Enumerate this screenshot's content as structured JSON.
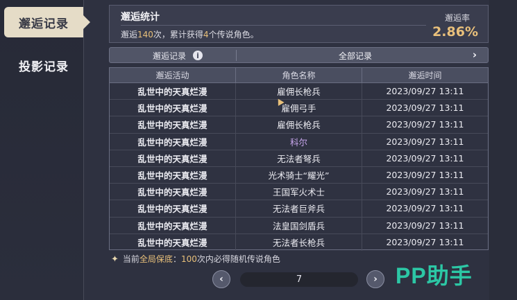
{
  "nav": {
    "encounter_tab": "邂逅记录",
    "projection_tab": "投影记录"
  },
  "stats": {
    "title": "邂逅统计",
    "summary_prefix": "邂逅",
    "count": "140",
    "summary_mid": "次，累计获得",
    "legend_count": "4",
    "summary_suffix": "个传说角色。",
    "rate_label": "邂逅率",
    "rate_value": "2.86%"
  },
  "filter": {
    "label": "邂逅记录",
    "info_icon": "i",
    "value": "全部记录",
    "arrow": "›"
  },
  "table": {
    "headers": [
      "邂逅活动",
      "角色名称",
      "邂逅时间"
    ],
    "rows": [
      {
        "activity": "乱世中的天真烂漫",
        "name": "雇佣长枪兵",
        "time": "2023/09/27 13:11",
        "name_color": "#ececf2"
      },
      {
        "activity": "乱世中的天真烂漫",
        "name": "雇佣弓手",
        "time": "2023/09/27 13:11",
        "name_color": "#ececf2"
      },
      {
        "activity": "乱世中的天真烂漫",
        "name": "雇佣长枪兵",
        "time": "2023/09/27 13:11",
        "name_color": "#ececf2"
      },
      {
        "activity": "乱世中的天真烂漫",
        "name": "科尔",
        "time": "2023/09/27 13:11",
        "name_color": "#c9a7ee"
      },
      {
        "activity": "乱世中的天真烂漫",
        "name": "无法者弩兵",
        "time": "2023/09/27 13:11",
        "name_color": "#ececf2"
      },
      {
        "activity": "乱世中的天真烂漫",
        "name": "光术骑士“耀光”",
        "time": "2023/09/27 13:11",
        "name_color": "#ececf2"
      },
      {
        "activity": "乱世中的天真烂漫",
        "name": "王国军火术士",
        "time": "2023/09/27 13:11",
        "name_color": "#ececf2"
      },
      {
        "activity": "乱世中的天真烂漫",
        "name": "无法者巨斧兵",
        "time": "2023/09/27 13:11",
        "name_color": "#ececf2"
      },
      {
        "activity": "乱世中的天真烂漫",
        "name": "法皇国剑盾兵",
        "time": "2023/09/27 13:11",
        "name_color": "#ececf2"
      },
      {
        "activity": "乱世中的天真烂漫",
        "name": "无法者长枪兵",
        "time": "2023/09/27 13:11",
        "name_color": "#ececf2"
      }
    ]
  },
  "note": {
    "prefix": "当前",
    "highlight1": "全局保底",
    "mid": "：",
    "highlight2": "100",
    "suffix": "次内必得随机传说角色"
  },
  "pagination": {
    "prev": "‹",
    "current_page": "7",
    "next": "›"
  },
  "watermark": "PP助手",
  "colors": {
    "accent_gold": "#e8c07a",
    "legend_purple": "#c9a7ee",
    "watermark_teal": "#2cc7a5"
  }
}
